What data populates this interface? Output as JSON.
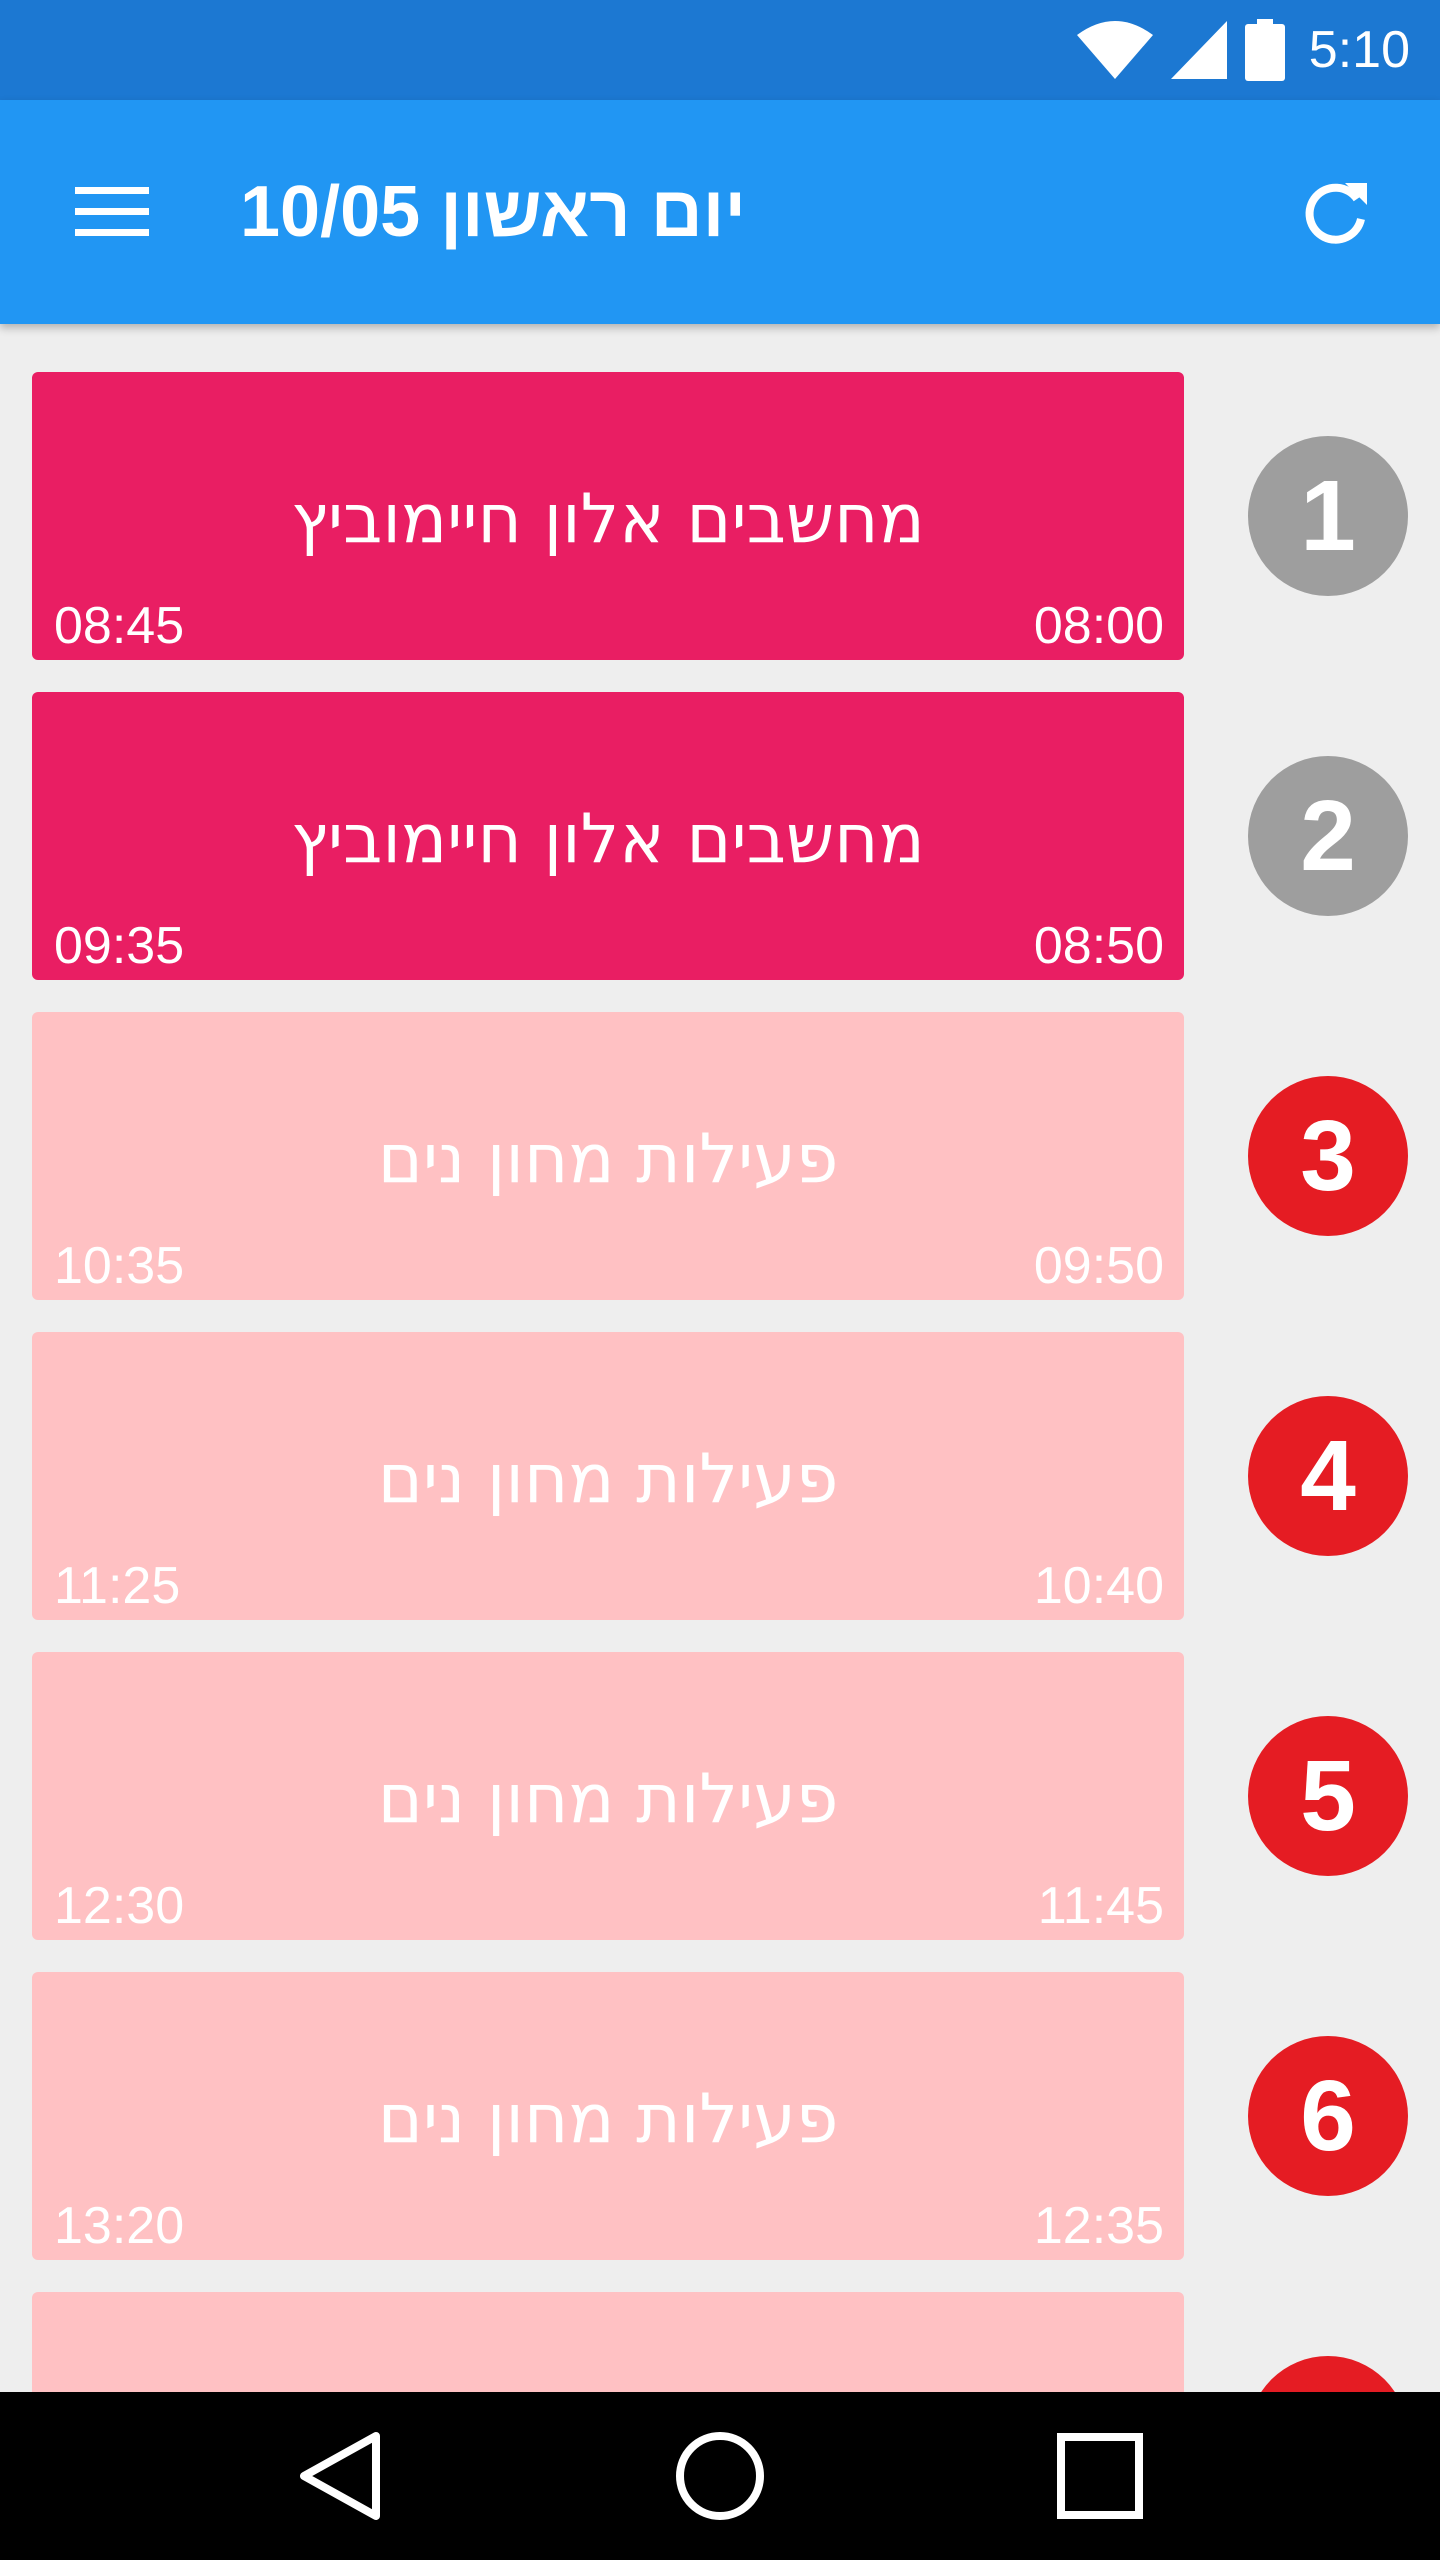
{
  "status_bar": {
    "time": "5:10",
    "icons": [
      "wifi-icon",
      "signal-icon",
      "battery-icon"
    ]
  },
  "app_bar": {
    "title": "יום ראשון 10/05",
    "menu_icon": "menu-icon",
    "refresh_icon": "refresh-icon"
  },
  "colors": {
    "status_bar": "#1c78d2",
    "app_bar": "#2196f3",
    "card_dark": "#e91e63",
    "card_light": "#ffc1c3",
    "circle_past": "#9e9e9e",
    "circle_future": "#e51c23",
    "background": "#eeeeee"
  },
  "lessons": [
    {
      "number": "1",
      "subject": "מחשבים אלון חיימוביץ",
      "start": "08:00",
      "end": "08:45",
      "state": "past"
    },
    {
      "number": "2",
      "subject": "מחשבים אלון חיימוביץ",
      "start": "08:50",
      "end": "09:35",
      "state": "past"
    },
    {
      "number": "3",
      "subject": "פעילות מחון נים",
      "start": "09:50",
      "end": "10:35",
      "state": "future"
    },
    {
      "number": "4",
      "subject": "פעילות מחון נים",
      "start": "10:40",
      "end": "11:25",
      "state": "future"
    },
    {
      "number": "5",
      "subject": "פעילות מחון נים",
      "start": "11:45",
      "end": "12:30",
      "state": "future"
    },
    {
      "number": "6",
      "subject": "פעילות מחון נים",
      "start": "12:35",
      "end": "13:20",
      "state": "future"
    },
    {
      "number": "",
      "subject": "",
      "start": "",
      "end": "",
      "state": "future"
    }
  ],
  "nav_bar": {
    "icons": [
      "back-icon",
      "home-icon",
      "recents-icon"
    ]
  }
}
